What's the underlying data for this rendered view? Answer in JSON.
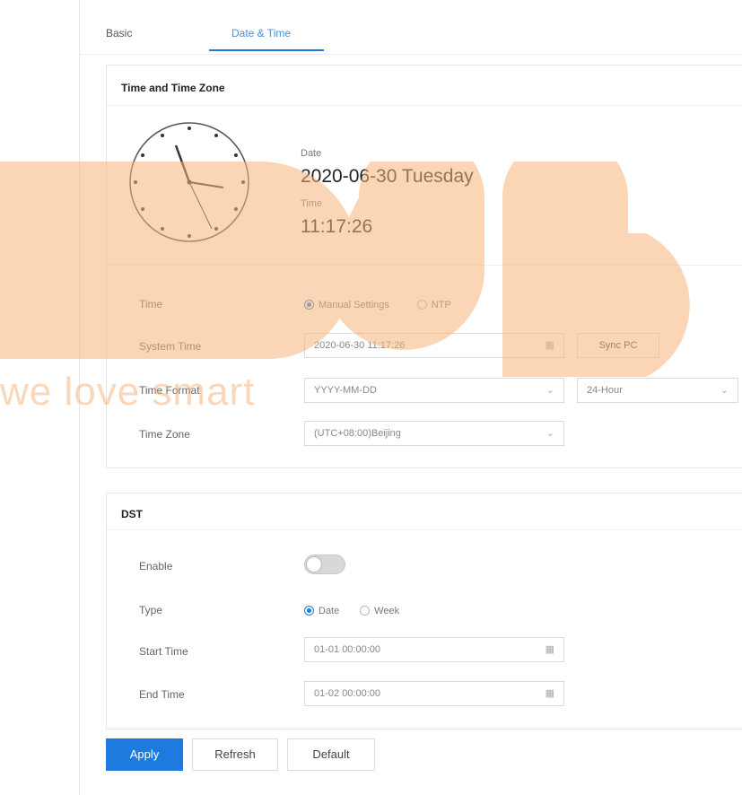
{
  "tabs": {
    "basic": "Basic",
    "date_time": "Date & Time"
  },
  "time_zone_panel": {
    "title": "Time and Time Zone",
    "date_label": "Date",
    "date_value": "2020-06-30 Tuesday",
    "time_label": "Time",
    "time_value": "11:17:26",
    "rows": {
      "time": {
        "label": "Time",
        "manual": "Manual Settings",
        "ntp": "NTP",
        "selected": "manual"
      },
      "system_time": {
        "label": "System Time",
        "value": "2020-06-30 11:17:26",
        "sync_button": "Sync PC"
      },
      "time_format": {
        "label": "Time Format",
        "date_format": "YYYY-MM-DD",
        "hour_format": "24-Hour"
      },
      "time_zone": {
        "label": "Time Zone",
        "value": "(UTC+08:00)Beijing"
      }
    }
  },
  "dst_panel": {
    "title": "DST",
    "enable": {
      "label": "Enable",
      "on": false
    },
    "type": {
      "label": "Type",
      "date": "Date",
      "week": "Week",
      "selected": "date"
    },
    "start_time": {
      "label": "Start Time",
      "value": "01-01 00:00:00"
    },
    "end_time": {
      "label": "End Time",
      "value": "01-02 00:00:00"
    }
  },
  "buttons": {
    "apply": "Apply",
    "refresh": "Refresh",
    "default": "Default"
  },
  "watermark": {
    "text": "we love smart",
    "color": "#f4a96a"
  },
  "colors": {
    "accent": "#1d7be0",
    "watermark": "#f8c79c"
  }
}
